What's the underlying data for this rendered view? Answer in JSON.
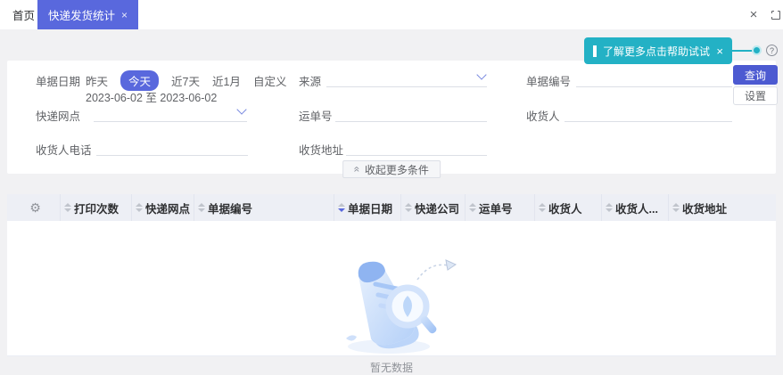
{
  "colors": {
    "accent": "#5968dd",
    "query_button": "#4c5ad1",
    "tooltip": "#23b1c5",
    "header_bg": "#edeff5"
  },
  "tabbar": {
    "home_label": "首页",
    "active_tab_label": "快递发货统计",
    "tab_close": "×",
    "window_close": "×"
  },
  "tooltip": {
    "text": "了解更多点击帮助试试",
    "close": "×"
  },
  "help_icon": "?",
  "actions": {
    "query": "查询",
    "settings": "设置"
  },
  "filters": {
    "doc_date": {
      "label": "单据日期",
      "options": [
        "昨天",
        "今天",
        "近7天",
        "近1月",
        "自定义"
      ],
      "selected": "今天",
      "range": "2023-06-02 至 2023-06-02"
    },
    "source": {
      "label": "来源",
      "value": ""
    },
    "doc_no": {
      "label": "单据编号",
      "value": ""
    },
    "outlet": {
      "label": "快递网点",
      "value": ""
    },
    "waybill": {
      "label": "运单号",
      "value": ""
    },
    "consignee": {
      "label": "收货人",
      "value": ""
    },
    "phone": {
      "label": "收货人电话",
      "value": ""
    },
    "address": {
      "label": "收货地址",
      "value": ""
    },
    "collapse_label": "收起更多条件",
    "collapse_icon": "«"
  },
  "table": {
    "gear_icon": "⚙",
    "columns": [
      "打印次数",
      "快递网点",
      "单据编号",
      "单据日期",
      "快递公司",
      "运单号",
      "收货人",
      "收货人...",
      "收货地址"
    ],
    "sorted_column": "单据日期",
    "sort_direction": "desc"
  },
  "empty_state": {
    "text": "暂无数据"
  }
}
